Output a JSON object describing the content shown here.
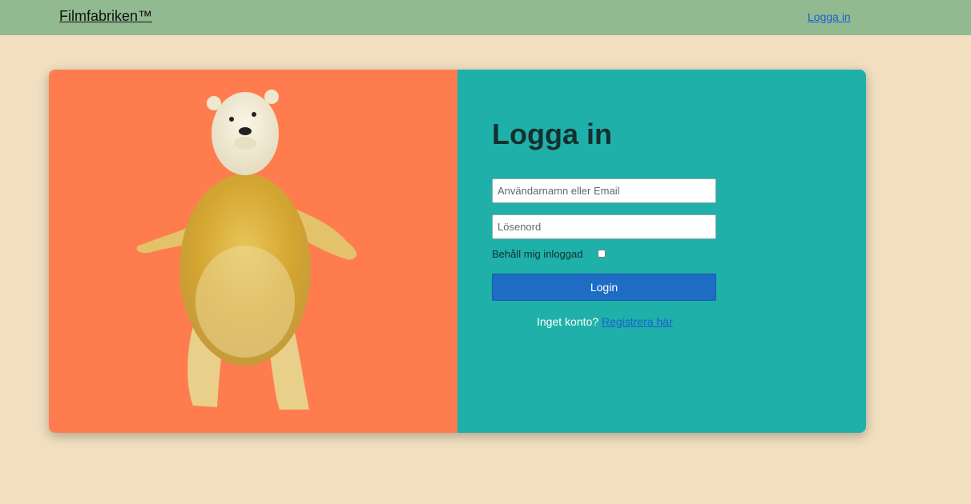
{
  "navbar": {
    "brand": "Filmfabriken™",
    "login_link": "Logga in"
  },
  "login": {
    "heading": "Logga in",
    "username_placeholder": "Användarnamn eller Email",
    "password_placeholder": "Lösenord",
    "remember_label": "Behåll mig inloggad",
    "remember_checked": false,
    "login_button": "Login",
    "no_account_text": "Inget konto?",
    "register_link": "Registrera här"
  },
  "colors": {
    "navbar_bg": "#91ba91",
    "page_bg": "#f1dfc0",
    "image_panel_bg": "#ff7c4e",
    "form_panel_bg": "#20b0aa",
    "button_bg": "#1e6cc4",
    "link": "#1a5fd0"
  },
  "image": {
    "subject": "polar-bear-illustration"
  }
}
